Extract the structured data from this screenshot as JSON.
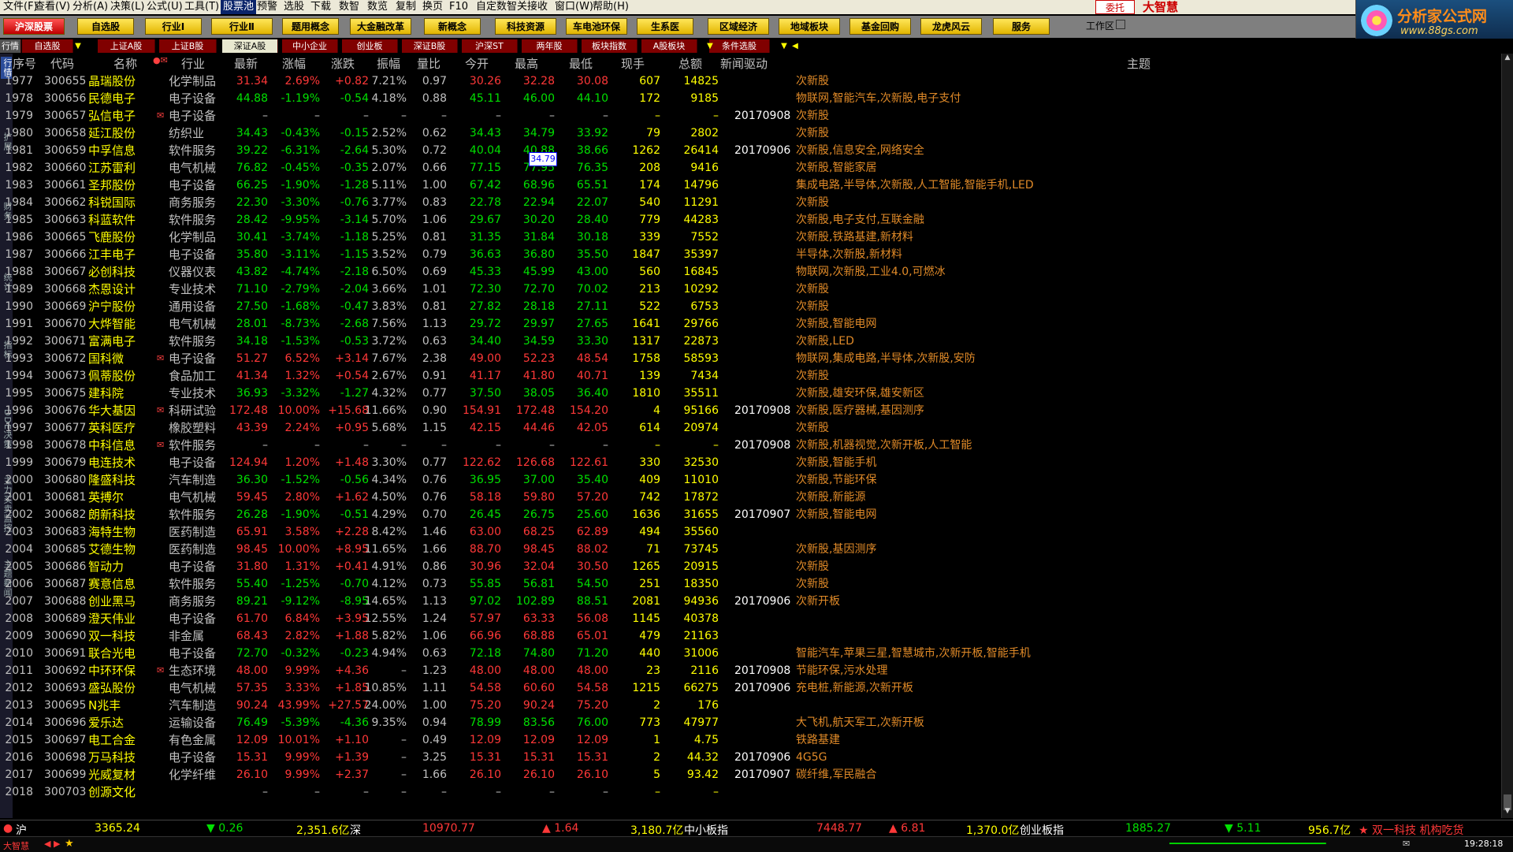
{
  "menu": {
    "items": [
      "文件(F)",
      "查看(V)",
      "分析(A)",
      "决策(L)",
      "公式(U)",
      "工具(T)",
      "股票池",
      "预警",
      "选股",
      "下载",
      "数智",
      "数览",
      "复制",
      "换页",
      "F10",
      "自定数智",
      "关接收",
      "窗口(W)",
      "帮助(H)"
    ],
    "active": "股票池",
    "brand_box": "委托",
    "brand_text": "大智慧"
  },
  "site_logo": {
    "title": "分析家公式网",
    "url_text": "www.88gs.com"
  },
  "toolbar": {
    "buttons": [
      "沪深股票",
      "自选股",
      "行业Ⅰ",
      "行业Ⅱ",
      "题用概念",
      "大金融改革",
      "新概念",
      "科技资源",
      "车电池环保",
      "生系医",
      "区域经济",
      "地域板块",
      "基金回购",
      "龙虎风云",
      "服务"
    ],
    "workspace": "工作区"
  },
  "tabs": {
    "items": [
      "行情",
      "自选股",
      "上证A股",
      "上证B股",
      "深证A股",
      "中小企业",
      "创业板",
      "深证B股",
      "沪深ST",
      "两年股",
      "板块指数",
      "A股板块",
      "条件选股"
    ],
    "active": "深证A股"
  },
  "side_tabs": [
    "行情",
    "扩展",
    "财务",
    "统计",
    "指标",
    "DDE决策",
    "主力买卖监控",
    "主题新闻"
  ],
  "columns": {
    "seq": "序号",
    "code": "代码",
    "name": "名称",
    "flag": "●✉",
    "industry": "行业",
    "last": "最新",
    "pct": "涨幅",
    "chg": "涨跌",
    "amp": "振幅",
    "vr": "量比",
    "open": "今开",
    "high": "最高",
    "low": "最低",
    "hand": "现手",
    "total": "总额",
    "news": "新闻驱动",
    "theme": "主题"
  },
  "tooltip": "34.79",
  "rows": [
    {
      "seq": "1977",
      "code": "300655",
      "name": "晶瑞股份",
      "flag": "",
      "ind": "化学制品",
      "last": "31.34",
      "pct": "2.69%",
      "chg": "+0.82",
      "amp": "7.21%",
      "vr": "0.97",
      "open": "30.26",
      "high": "32.28",
      "low": "30.08",
      "hand": "607",
      "total": "14825",
      "date": "",
      "news": "次新股",
      "dir": "up"
    },
    {
      "seq": "1978",
      "code": "300656",
      "name": "民德电子",
      "flag": "",
      "ind": "电子设备",
      "last": "44.88",
      "pct": "-1.19%",
      "chg": "-0.54",
      "amp": "4.18%",
      "vr": "0.88",
      "open": "45.11",
      "high": "46.00",
      "low": "44.10",
      "hand": "172",
      "total": "9185",
      "date": "",
      "news": "物联网,智能汽车,次新股,电子支付",
      "dir": "dn"
    },
    {
      "seq": "1979",
      "code": "300657",
      "name": "弘信电子",
      "flag": "✉",
      "ind": "电子设备",
      "last": "–",
      "pct": "–",
      "chg": "–",
      "amp": "–",
      "vr": "–",
      "open": "–",
      "high": "–",
      "low": "–",
      "hand": "–",
      "total": "–",
      "date": "20170908",
      "news": "次新股",
      "dir": "wt"
    },
    {
      "seq": "1980",
      "code": "300658",
      "name": "延江股份",
      "flag": "",
      "ind": "纺织业",
      "last": "34.43",
      "pct": "-0.43%",
      "chg": "-0.15",
      "amp": "2.52%",
      "vr": "0.62",
      "open": "34.43",
      "high": "34.79",
      "low": "33.92",
      "hand": "79",
      "total": "2802",
      "date": "",
      "news": "次新股",
      "dir": "dn"
    },
    {
      "seq": "1981",
      "code": "300659",
      "name": "中孚信息",
      "flag": "",
      "ind": "软件服务",
      "last": "39.22",
      "pct": "-6.31%",
      "chg": "-2.64",
      "amp": "5.30%",
      "vr": "0.72",
      "open": "40.04",
      "high": "40.88",
      "low": "38.66",
      "hand": "1262",
      "total": "26414",
      "date": "20170906",
      "news": "次新股,信息安全,网络安全",
      "dir": "dn"
    },
    {
      "seq": "1982",
      "code": "300660",
      "name": "江苏雷利",
      "flag": "",
      "ind": "电气机械",
      "last": "76.82",
      "pct": "-0.45%",
      "chg": "-0.35",
      "amp": "2.07%",
      "vr": "0.66",
      "open": "77.15",
      "high": "77.95",
      "low": "76.35",
      "hand": "208",
      "total": "9416",
      "date": "",
      "news": "次新股,智能家居",
      "dir": "dn"
    },
    {
      "seq": "1983",
      "code": "300661",
      "name": "圣邦股份",
      "flag": "",
      "ind": "电子设备",
      "last": "66.25",
      "pct": "-1.90%",
      "chg": "-1.28",
      "amp": "5.11%",
      "vr": "1.00",
      "open": "67.42",
      "high": "68.96",
      "low": "65.51",
      "hand": "174",
      "total": "14796",
      "date": "",
      "news": "集成电路,半导体,次新股,人工智能,智能手机,LED",
      "dir": "dn"
    },
    {
      "seq": "1984",
      "code": "300662",
      "name": "科锐国际",
      "flag": "",
      "ind": "商务服务",
      "last": "22.30",
      "pct": "-3.30%",
      "chg": "-0.76",
      "amp": "3.77%",
      "vr": "0.83",
      "open": "22.78",
      "high": "22.94",
      "low": "22.07",
      "hand": "540",
      "total": "11291",
      "date": "",
      "news": "次新股",
      "dir": "dn"
    },
    {
      "seq": "1985",
      "code": "300663",
      "name": "科蓝软件",
      "flag": "",
      "ind": "软件服务",
      "last": "28.42",
      "pct": "-9.95%",
      "chg": "-3.14",
      "amp": "5.70%",
      "vr": "1.06",
      "open": "29.67",
      "high": "30.20",
      "low": "28.40",
      "hand": "779",
      "total": "44283",
      "date": "",
      "news": "次新股,电子支付,互联金融",
      "dir": "dn"
    },
    {
      "seq": "1986",
      "code": "300665",
      "name": "飞鹿股份",
      "flag": "",
      "ind": "化学制品",
      "last": "30.41",
      "pct": "-3.74%",
      "chg": "-1.18",
      "amp": "5.25%",
      "vr": "0.81",
      "open": "31.35",
      "high": "31.84",
      "low": "30.18",
      "hand": "339",
      "total": "7552",
      "date": "",
      "news": "次新股,铁路基建,新材料",
      "dir": "dn"
    },
    {
      "seq": "1987",
      "code": "300666",
      "name": "江丰电子",
      "flag": "",
      "ind": "电子设备",
      "last": "35.80",
      "pct": "-3.11%",
      "chg": "-1.15",
      "amp": "3.52%",
      "vr": "0.79",
      "open": "36.63",
      "high": "36.80",
      "low": "35.50",
      "hand": "1847",
      "total": "35397",
      "date": "",
      "news": "半导体,次新股,新材料",
      "dir": "dn"
    },
    {
      "seq": "1988",
      "code": "300667",
      "name": "必创科技",
      "flag": "",
      "ind": "仪器仪表",
      "last": "43.82",
      "pct": "-4.74%",
      "chg": "-2.18",
      "amp": "6.50%",
      "vr": "0.69",
      "open": "45.33",
      "high": "45.99",
      "low": "43.00",
      "hand": "560",
      "total": "16845",
      "date": "",
      "news": "物联网,次新股,工业4.0,可燃冰",
      "dir": "dn"
    },
    {
      "seq": "1989",
      "code": "300668",
      "name": "杰恩设计",
      "flag": "",
      "ind": "专业技术",
      "last": "71.10",
      "pct": "-2.79%",
      "chg": "-2.04",
      "amp": "3.66%",
      "vr": "1.01",
      "open": "72.30",
      "high": "72.70",
      "low": "70.02",
      "hand": "213",
      "total": "10292",
      "date": "",
      "news": "次新股",
      "dir": "dn"
    },
    {
      "seq": "1990",
      "code": "300669",
      "name": "沪宁股份",
      "flag": "",
      "ind": "通用设备",
      "last": "27.50",
      "pct": "-1.68%",
      "chg": "-0.47",
      "amp": "3.83%",
      "vr": "0.81",
      "open": "27.82",
      "high": "28.18",
      "low": "27.11",
      "hand": "522",
      "total": "6753",
      "date": "",
      "news": "次新股",
      "dir": "dn"
    },
    {
      "seq": "1991",
      "code": "300670",
      "name": "大烨智能",
      "flag": "",
      "ind": "电气机械",
      "last": "28.01",
      "pct": "-8.73%",
      "chg": "-2.68",
      "amp": "7.56%",
      "vr": "1.13",
      "open": "29.72",
      "high": "29.97",
      "low": "27.65",
      "hand": "1641",
      "total": "29766",
      "date": "",
      "news": "次新股,智能电网",
      "dir": "dn"
    },
    {
      "seq": "1992",
      "code": "300671",
      "name": "富满电子",
      "flag": "",
      "ind": "软件服务",
      "last": "34.18",
      "pct": "-1.53%",
      "chg": "-0.53",
      "amp": "3.72%",
      "vr": "0.63",
      "open": "34.40",
      "high": "34.59",
      "low": "33.30",
      "hand": "1317",
      "total": "22873",
      "date": "",
      "news": "次新股,LED",
      "dir": "dn"
    },
    {
      "seq": "1993",
      "code": "300672",
      "name": "国科微",
      "flag": "✉",
      "ind": "电子设备",
      "last": "51.27",
      "pct": "6.52%",
      "chg": "+3.14",
      "amp": "7.67%",
      "vr": "2.38",
      "open": "49.00",
      "high": "52.23",
      "low": "48.54",
      "hand": "1758",
      "total": "58593",
      "date": "",
      "news": "物联网,集成电路,半导体,次新股,安防",
      "dir": "up"
    },
    {
      "seq": "1994",
      "code": "300673",
      "name": "佩蒂股份",
      "flag": "",
      "ind": "食品加工",
      "last": "41.34",
      "pct": "1.32%",
      "chg": "+0.54",
      "amp": "2.67%",
      "vr": "0.91",
      "open": "41.17",
      "high": "41.80",
      "low": "40.71",
      "hand": "139",
      "total": "7434",
      "date": "",
      "news": "次新股",
      "dir": "up"
    },
    {
      "seq": "1995",
      "code": "300675",
      "name": "建科院",
      "flag": "",
      "ind": "专业技术",
      "last": "36.93",
      "pct": "-3.32%",
      "chg": "-1.27",
      "amp": "4.32%",
      "vr": "0.77",
      "open": "37.50",
      "high": "38.05",
      "low": "36.40",
      "hand": "1810",
      "total": "35511",
      "date": "",
      "news": "次新股,雄安环保,雄安新区",
      "dir": "dn"
    },
    {
      "seq": "1996",
      "code": "300676",
      "name": "华大基因",
      "flag": "✉",
      "ind": "科研试验",
      "last": "172.48",
      "pct": "10.00%",
      "chg": "+15.68",
      "amp": "11.66%",
      "vr": "0.90",
      "open": "154.91",
      "high": "172.48",
      "low": "154.20",
      "hand": "4",
      "total": "95166",
      "date": "20170908",
      "news": "次新股,医疗器械,基因测序",
      "dir": "up"
    },
    {
      "seq": "1997",
      "code": "300677",
      "name": "英科医疗",
      "flag": "",
      "ind": "橡胶塑料",
      "last": "43.39",
      "pct": "2.24%",
      "chg": "+0.95",
      "amp": "5.68%",
      "vr": "1.15",
      "open": "42.15",
      "high": "44.46",
      "low": "42.05",
      "hand": "614",
      "total": "20974",
      "date": "",
      "news": "次新股",
      "dir": "up"
    },
    {
      "seq": "1998",
      "code": "300678",
      "name": "中科信息",
      "flag": "✉",
      "ind": "软件服务",
      "last": "–",
      "pct": "–",
      "chg": "–",
      "amp": "–",
      "vr": "–",
      "open": "–",
      "high": "–",
      "low": "–",
      "hand": "–",
      "total": "–",
      "date": "20170908",
      "news": "次新股,机器视觉,次新开板,人工智能",
      "dir": "wt"
    },
    {
      "seq": "1999",
      "code": "300679",
      "name": "电连技术",
      "flag": "",
      "ind": "电子设备",
      "last": "124.94",
      "pct": "1.20%",
      "chg": "+1.48",
      "amp": "3.30%",
      "vr": "0.77",
      "open": "122.62",
      "high": "126.68",
      "low": "122.61",
      "hand": "330",
      "total": "32530",
      "date": "",
      "news": "次新股,智能手机",
      "dir": "up"
    },
    {
      "seq": "2000",
      "code": "300680",
      "name": "隆盛科技",
      "flag": "",
      "ind": "汽车制造",
      "last": "36.30",
      "pct": "-1.52%",
      "chg": "-0.56",
      "amp": "4.34%",
      "vr": "0.76",
      "open": "36.95",
      "high": "37.00",
      "low": "35.40",
      "hand": "409",
      "total": "11010",
      "date": "",
      "news": "次新股,节能环保",
      "dir": "dn"
    },
    {
      "seq": "2001",
      "code": "300681",
      "name": "英搏尔",
      "flag": "",
      "ind": "电气机械",
      "last": "59.45",
      "pct": "2.80%",
      "chg": "+1.62",
      "amp": "4.50%",
      "vr": "0.76",
      "open": "58.18",
      "high": "59.80",
      "low": "57.20",
      "hand": "742",
      "total": "17872",
      "date": "",
      "news": "次新股,新能源",
      "dir": "up"
    },
    {
      "seq": "2002",
      "code": "300682",
      "name": "朗新科技",
      "flag": "",
      "ind": "软件服务",
      "last": "26.28",
      "pct": "-1.90%",
      "chg": "-0.51",
      "amp": "4.29%",
      "vr": "0.70",
      "open": "26.45",
      "high": "26.75",
      "low": "25.60",
      "hand": "1636",
      "total": "31655",
      "date": "20170907",
      "news": "次新股,智能电网",
      "dir": "dn"
    },
    {
      "seq": "2003",
      "code": "300683",
      "name": "海特生物",
      "flag": "",
      "ind": "医药制造",
      "last": "65.91",
      "pct": "3.58%",
      "chg": "+2.28",
      "amp": "8.42%",
      "vr": "1.46",
      "open": "63.00",
      "high": "68.25",
      "low": "62.89",
      "hand": "494",
      "total": "35560",
      "date": "",
      "news": "",
      "dir": "up"
    },
    {
      "seq": "2004",
      "code": "300685",
      "name": "艾德生物",
      "flag": "",
      "ind": "医药制造",
      "last": "98.45",
      "pct": "10.00%",
      "chg": "+8.95",
      "amp": "11.65%",
      "vr": "1.66",
      "open": "88.70",
      "high": "98.45",
      "low": "88.02",
      "hand": "71",
      "total": "73745",
      "date": "",
      "news": "次新股,基因测序",
      "dir": "up"
    },
    {
      "seq": "2005",
      "code": "300686",
      "name": "智动力",
      "flag": "",
      "ind": "电子设备",
      "last": "31.80",
      "pct": "1.31%",
      "chg": "+0.41",
      "amp": "4.91%",
      "vr": "0.86",
      "open": "30.96",
      "high": "32.04",
      "low": "30.50",
      "hand": "1265",
      "total": "20915",
      "date": "",
      "news": "次新股",
      "dir": "up"
    },
    {
      "seq": "2006",
      "code": "300687",
      "name": "赛意信息",
      "flag": "",
      "ind": "软件服务",
      "last": "55.40",
      "pct": "-1.25%",
      "chg": "-0.70",
      "amp": "4.12%",
      "vr": "0.73",
      "open": "55.85",
      "high": "56.81",
      "low": "54.50",
      "hand": "251",
      "total": "18350",
      "date": "",
      "news": "次新股",
      "dir": "dn"
    },
    {
      "seq": "2007",
      "code": "300688",
      "name": "创业黑马",
      "flag": "",
      "ind": "商务服务",
      "last": "89.21",
      "pct": "-9.12%",
      "chg": "-8.95",
      "amp": "14.65%",
      "vr": "1.13",
      "open": "97.02",
      "high": "102.89",
      "low": "88.51",
      "hand": "2081",
      "total": "94936",
      "date": "20170906",
      "news": "次新开板",
      "dir": "dn"
    },
    {
      "seq": "2008",
      "code": "300689",
      "name": "澄天伟业",
      "flag": "",
      "ind": "电子设备",
      "last": "61.70",
      "pct": "6.84%",
      "chg": "+3.95",
      "amp": "12.55%",
      "vr": "1.24",
      "open": "57.97",
      "high": "63.33",
      "low": "56.08",
      "hand": "1145",
      "total": "40378",
      "date": "",
      "news": "",
      "dir": "up"
    },
    {
      "seq": "2009",
      "code": "300690",
      "name": "双一科技",
      "flag": "",
      "ind": "非金属",
      "last": "68.43",
      "pct": "2.82%",
      "chg": "+1.88",
      "amp": "5.82%",
      "vr": "1.06",
      "open": "66.96",
      "high": "68.88",
      "low": "65.01",
      "hand": "479",
      "total": "21163",
      "date": "",
      "news": "",
      "dir": "up"
    },
    {
      "seq": "2010",
      "code": "300691",
      "name": "联合光电",
      "flag": "",
      "ind": "电子设备",
      "last": "72.70",
      "pct": "-0.32%",
      "chg": "-0.23",
      "amp": "4.94%",
      "vr": "0.63",
      "open": "72.18",
      "high": "74.80",
      "low": "71.20",
      "hand": "440",
      "total": "31006",
      "date": "",
      "news": "智能汽车,苹果三星,智慧城市,次新开板,智能手机",
      "dir": "dn"
    },
    {
      "seq": "2011",
      "code": "300692",
      "name": "中环环保",
      "flag": "✉",
      "ind": "生态环境",
      "last": "48.00",
      "pct": "9.99%",
      "chg": "+4.36",
      "amp": "–",
      "vr": "1.23",
      "open": "48.00",
      "high": "48.00",
      "low": "48.00",
      "hand": "23",
      "total": "2116",
      "date": "20170908",
      "news": "节能环保,污水处理",
      "dir": "up"
    },
    {
      "seq": "2012",
      "code": "300693",
      "name": "盛弘股份",
      "flag": "",
      "ind": "电气机械",
      "last": "57.35",
      "pct": "3.33%",
      "chg": "+1.85",
      "amp": "10.85%",
      "vr": "1.11",
      "open": "54.58",
      "high": "60.60",
      "low": "54.58",
      "hand": "1215",
      "total": "66275",
      "date": "20170906",
      "news": "充电桩,新能源,次新开板",
      "dir": "up"
    },
    {
      "seq": "2013",
      "code": "300695",
      "name": "N兆丰",
      "flag": "",
      "ind": "汽车制造",
      "last": "90.24",
      "pct": "43.99%",
      "chg": "+27.57",
      "amp": "24.00%",
      "vr": "1.00",
      "open": "75.20",
      "high": "90.24",
      "low": "75.20",
      "hand": "2",
      "total": "176",
      "date": "",
      "news": "",
      "dir": "up"
    },
    {
      "seq": "2014",
      "code": "300696",
      "name": "爱乐达",
      "flag": "",
      "ind": "运输设备",
      "last": "76.49",
      "pct": "-5.39%",
      "chg": "-4.36",
      "amp": "9.35%",
      "vr": "0.94",
      "open": "78.99",
      "high": "83.56",
      "low": "76.00",
      "hand": "773",
      "total": "47977",
      "date": "",
      "news": "大飞机,航天军工,次新开板",
      "dir": "dn"
    },
    {
      "seq": "2015",
      "code": "300697",
      "name": "电工合金",
      "flag": "",
      "ind": "有色金属",
      "last": "12.09",
      "pct": "10.01%",
      "chg": "+1.10",
      "amp": "–",
      "vr": "0.49",
      "open": "12.09",
      "high": "12.09",
      "low": "12.09",
      "hand": "1",
      "total": "4.75",
      "date": "",
      "news": "铁路基建",
      "dir": "up"
    },
    {
      "seq": "2016",
      "code": "300698",
      "name": "万马科技",
      "flag": "",
      "ind": "电子设备",
      "last": "15.31",
      "pct": "9.99%",
      "chg": "+1.39",
      "amp": "–",
      "vr": "3.25",
      "open": "15.31",
      "high": "15.31",
      "low": "15.31",
      "hand": "2",
      "total": "44.32",
      "date": "20170906",
      "news": "4G5G",
      "dir": "up"
    },
    {
      "seq": "2017",
      "code": "300699",
      "name": "光威复材",
      "flag": "",
      "ind": "化学纤维",
      "last": "26.10",
      "pct": "9.99%",
      "chg": "+2.37",
      "amp": "–",
      "vr": "1.66",
      "open": "26.10",
      "high": "26.10",
      "low": "26.10",
      "hand": "5",
      "total": "93.42",
      "date": "20170907",
      "news": "碳纤维,军民融合",
      "dir": "up"
    },
    {
      "seq": "2018",
      "code": "300703",
      "name": "创源文化",
      "flag": "",
      "ind": "",
      "last": "–",
      "pct": "–",
      "chg": "–",
      "amp": "–",
      "vr": "–",
      "open": "–",
      "high": "–",
      "low": "–",
      "hand": "–",
      "total": "–",
      "date": "",
      "news": "",
      "dir": "wt"
    }
  ],
  "status": {
    "sh_label": "沪",
    "sh_index": "3365.24",
    "sh_chg": "▼ 0.26",
    "sh_amt": "2,351.6亿",
    "sz_label": "深",
    "sz_index": "10970.77",
    "sz_chg": "▲ 1.64",
    "sz_amt": "3,180.7亿",
    "zx_label": "中小板指",
    "zx_index": "7448.77",
    "zx_chg": "▲ 6.81",
    "zx_amt": "1,370.0亿",
    "cy_label": "创业板指",
    "cy_index": "1885.27",
    "cy_chg": "▼ 5.11",
    "cy_amt": "956.7亿",
    "ticker": "★ 双一科技 机构吃货",
    "bottom_brand": "大智慧",
    "time": "19:28:18"
  },
  "colors": {
    "up": "#ff3838",
    "down": "#00e000",
    "name": "#ffff00",
    "news": "#e08a28"
  }
}
